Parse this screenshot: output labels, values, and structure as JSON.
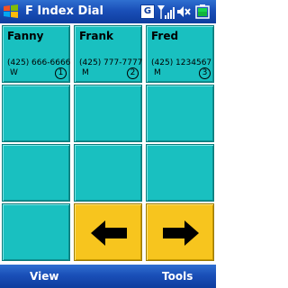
{
  "titlebar": {
    "title": "F Index Dial",
    "g_indicator": "G",
    "icons": [
      "windows-start-icon",
      "signal-strength-icon",
      "volume-mute-icon",
      "battery-icon"
    ]
  },
  "contacts": [
    {
      "name": "Fanny",
      "phone": "(425) 666-6666",
      "type": "W",
      "index": "1"
    },
    {
      "name": "Frank",
      "phone": "(425) 777-7777",
      "type": "M",
      "index": "2"
    },
    {
      "name": "Fred",
      "phone": "(425) 1234567",
      "type": "M",
      "index": "3"
    }
  ],
  "navigation": {
    "prev_icon": "arrow-left-icon",
    "next_icon": "arrow-right-icon"
  },
  "menubar": {
    "left": "View",
    "right": "Tools"
  },
  "colors": {
    "titlebar": "#1a4fb8",
    "tile": "#19c0c0",
    "nav_tile": "#f7c51e"
  }
}
